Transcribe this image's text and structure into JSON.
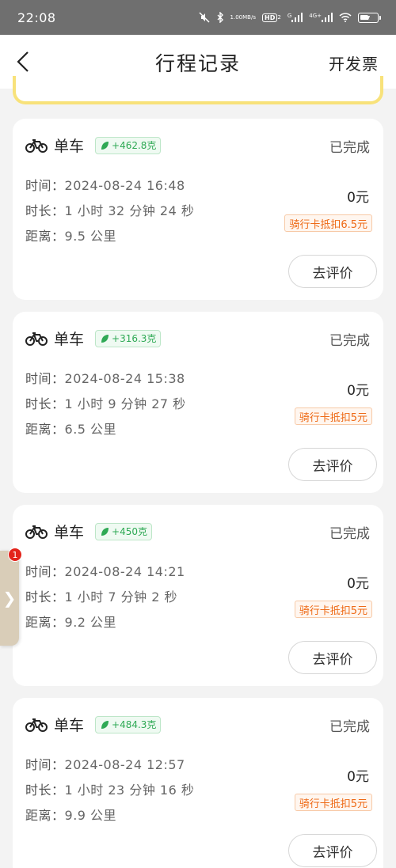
{
  "status_bar": {
    "time": "22:08",
    "speed_value": "1.00",
    "speed_unit": "MB/s",
    "hd_label": "HD",
    "hd_sub": "2",
    "network_g": "G",
    "network_4g": "4G+",
    "battery": "71"
  },
  "nav": {
    "title": "行程记录",
    "right_action": "开发票"
  },
  "trips": [
    {
      "vehicle": "单车",
      "carbon": "+462.8克",
      "status": "已完成",
      "time_label": "时间：",
      "time_value": "2024-08-24 16:48",
      "duration_label": "时长：",
      "duration_value": "1 小时 32 分钟 24 秒",
      "distance_label": "距离：",
      "distance_value": "9.5 公里",
      "price": "0元",
      "discount": "骑行卡抵扣6.5元",
      "review_label": "去评价"
    },
    {
      "vehicle": "单车",
      "carbon": "+316.3克",
      "status": "已完成",
      "time_label": "时间：",
      "time_value": "2024-08-24 15:38",
      "duration_label": "时长：",
      "duration_value": "1 小时 9 分钟 27 秒",
      "distance_label": "距离：",
      "distance_value": "6.5 公里",
      "price": "0元",
      "discount": "骑行卡抵扣5元",
      "review_label": "去评价"
    },
    {
      "vehicle": "单车",
      "carbon": "+450克",
      "status": "已完成",
      "time_label": "时间：",
      "time_value": "2024-08-24 14:21",
      "duration_label": "时长：",
      "duration_value": "1 小时 7 分钟 2 秒",
      "distance_label": "距离：",
      "distance_value": "9.2 公里",
      "price": "0元",
      "discount": "骑行卡抵扣5元",
      "review_label": "去评价"
    },
    {
      "vehicle": "单车",
      "carbon": "+484.3克",
      "status": "已完成",
      "time_label": "时间：",
      "time_value": "2024-08-24 12:57",
      "duration_label": "时长：",
      "duration_value": "1 小时 23 分钟 16 秒",
      "distance_label": "距离：",
      "distance_value": "9.9 公里",
      "price": "0元",
      "discount": "骑行卡抵扣5元",
      "review_label": "去评价"
    }
  ],
  "side_tab": {
    "badge": "1",
    "arrow": "❯"
  },
  "colors": {
    "status_bar_bg": "#6f6f6f",
    "page_bg": "#f3f3f3",
    "carbon_green": "#2fa955",
    "discount_orange": "#ee6a16",
    "banner_yellow": "#f8e27a",
    "badge_red": "#e3241b"
  }
}
